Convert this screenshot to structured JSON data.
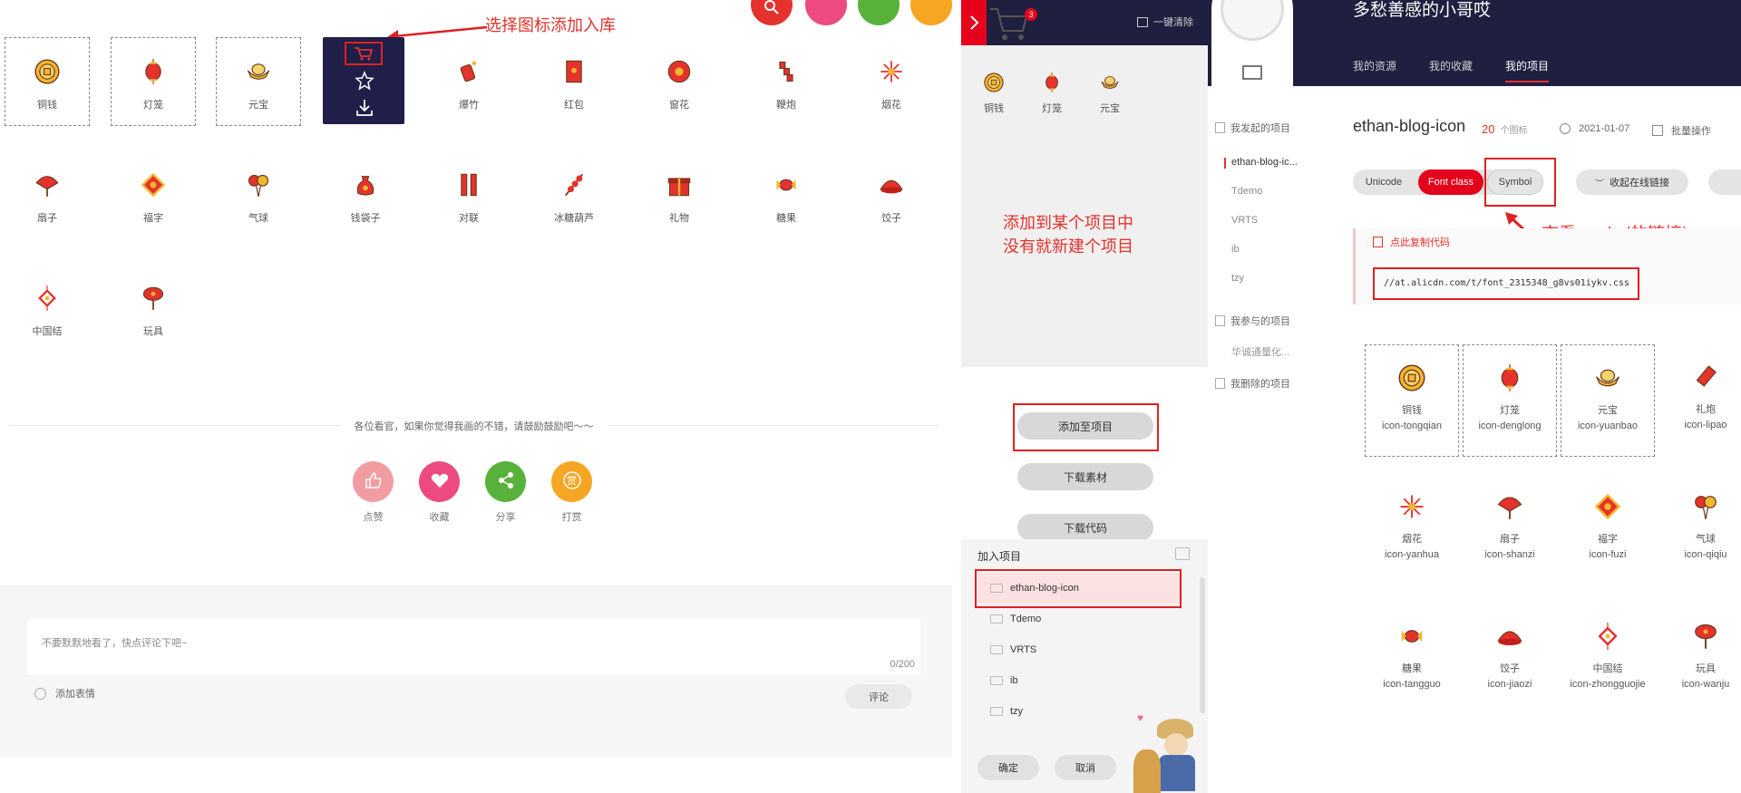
{
  "left": {
    "annotation": "选择图标添加入库",
    "icons": [
      {
        "label": "铜钱",
        "icon": "coin-icon"
      },
      {
        "label": "灯笼",
        "icon": "lantern-icon"
      },
      {
        "label": "元宝",
        "icon": "ingot-icon"
      },
      {
        "label": "",
        "icon": "hover-actions"
      },
      {
        "label": "爆竹",
        "icon": "firecracker-icon"
      },
      {
        "label": "红包",
        "icon": "red-envelope-icon"
      },
      {
        "label": "窗花",
        "icon": "paper-cut-icon"
      },
      {
        "label": "鞭炮",
        "icon": "firecrackers-string-icon"
      },
      {
        "label": "烟花",
        "icon": "fireworks-icon"
      },
      {
        "label": "扇子",
        "icon": "fan-icon"
      },
      {
        "label": "福字",
        "icon": "fu-character-icon"
      },
      {
        "label": "气球",
        "icon": "balloon-icon"
      },
      {
        "label": "钱袋子",
        "icon": "money-bag-icon"
      },
      {
        "label": "对联",
        "icon": "couplet-icon"
      },
      {
        "label": "冰糖葫芦",
        "icon": "candied-haws-icon"
      },
      {
        "label": "礼物",
        "icon": "gift-icon"
      },
      {
        "label": "糖果",
        "icon": "candy-icon"
      },
      {
        "label": "饺子",
        "icon": "dumpling-icon"
      },
      {
        "label": "中国结",
        "icon": "chinese-knot-icon"
      },
      {
        "label": "玩具",
        "icon": "toy-icon"
      }
    ],
    "cart_badge": "",
    "praise_text": "各位看官，如果你觉得我画的不错，请鼓励鼓励吧～～",
    "actions": [
      {
        "label": "点赞",
        "color": "#f19ca0",
        "icon": "thumb-up-icon"
      },
      {
        "label": "收藏",
        "color": "#ec4a80",
        "icon": "heart-icon"
      },
      {
        "label": "分享",
        "color": "#57b23c",
        "icon": "share-icon"
      },
      {
        "label": "打赏",
        "color": "#f6a623",
        "icon": "reward-icon"
      }
    ],
    "comment_placeholder": "不要默默地看了，快点评论下吧~",
    "comment_count": "0/200",
    "emoji_label": "添加表情",
    "comment_button": "评论",
    "top_circles": [
      "#e5322c",
      "#ec4a80",
      "#57b23c",
      "#f6a623"
    ],
    "reward_glyph": "赏"
  },
  "middle": {
    "cart_count": "3",
    "clear_label": "一键清除",
    "cart_icons": [
      {
        "label": "铜钱"
      },
      {
        "label": "灯笼"
      },
      {
        "label": "元宝"
      }
    ],
    "annotation_line1": "添加到某个项目中",
    "annotation_line2": "没有就新建个项目",
    "btn_add": "添加至项目",
    "btn_download_material": "下载素材",
    "btn_download_code": "下载代码",
    "join_project": "加入项目",
    "projects": [
      "ethan-blog-icon",
      "Tdemo",
      "VRTS",
      "ib",
      "tzy"
    ],
    "confirm": "确定",
    "cancel": "取消"
  },
  "right": {
    "username": "多愁善感的小哥哎",
    "tabs": [
      "我的资源",
      "我的收藏",
      "我的项目"
    ],
    "active_tab": 2,
    "side_initiated": "我发起的项目",
    "side_projects": [
      "ethan-blog-ic...",
      "Tdemo",
      "VRTS",
      "ib",
      "tzy"
    ],
    "side_joined": "我参与的项目",
    "side_joined_items": [
      "华诚通量化..."
    ],
    "side_deleted": "我删除的项目",
    "project_title": "ethan-blog-icon",
    "icon_count": "20",
    "icon_count_unit": "个图标",
    "date": "2021-01-07",
    "batch": "批量操作",
    "format_tabs": [
      "Unicode",
      "Font class",
      "Symbol"
    ],
    "active_format": 1,
    "online_link_btn": "收起在线链接",
    "annotation": "查看symbol的链接js",
    "copy_code": "点此复制代码",
    "link": "//at.alicdn.com/t/font_2315348_g8vs01iykv.css",
    "icons": [
      {
        "name": "铜钱",
        "code": "icon-tongqian"
      },
      {
        "name": "灯笼",
        "code": "icon-denglong"
      },
      {
        "name": "元宝",
        "code": "icon-yuanbao"
      },
      {
        "name": "礼炮",
        "code": "icon-lipao"
      },
      {
        "name": "烟花",
        "code": "icon-yanhua"
      },
      {
        "name": "扇子",
        "code": "icon-shanzi"
      },
      {
        "name": "福字",
        "code": "icon-fuzi"
      },
      {
        "name": "气球",
        "code": "icon-qiqiu"
      },
      {
        "name": "糖果",
        "code": "icon-tangguo"
      },
      {
        "name": "饺子",
        "code": "icon-jiaozi"
      },
      {
        "name": "中国结",
        "code": "icon-zhongguojie"
      },
      {
        "name": "玩具",
        "code": "icon-wanju"
      }
    ]
  }
}
